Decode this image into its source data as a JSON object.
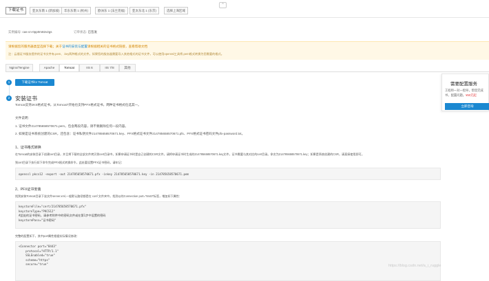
{
  "top_tabs": [
    {
      "label": "下载证书",
      "active": true
    },
    {
      "label": "亚太东南 1 (新加坡)",
      "active": false
    },
    {
      "label": "华东东南 1 (杭州)",
      "active": false
    },
    {
      "label": "欧洲东 1 (法兰克福)",
      "active": false
    },
    {
      "label": "亚太东北 1 (东京)",
      "active": false
    },
    {
      "label": "选择上海区域",
      "active": false
    }
  ],
  "up_button": "^",
  "order": {
    "instance_label": "实例编号:",
    "instance_value": "cas-cn-0pp0m82v2gs",
    "status_label": "订单状态:",
    "status_value": "已签发"
  },
  "notice": {
    "line1_prefix": "请根据您的服务器类型选择下载；关于",
    "line1_link": "证书的安装与配置",
    "line1_suffix": "请根据相关的证书格式链接，查看帮助文档",
    "line2": "注：云盾证书服务提供的证书文件有.pem、.key两种格式的文件。如果您的服务器需要导入其他格式的证书文件，可以使用openssl工具将.pem格式转换为您需要的格式。"
  },
  "server_tabs": [
    "Nginx/Tengine",
    "Apache",
    "Tomcat",
    "IIS 6",
    "IIS 7/8",
    "其他"
  ],
  "active_server_tab": 2,
  "step1": {
    "number": "1",
    "button": "下载证书for Tomcat"
  },
  "step2": {
    "number": "2",
    "title": "安装证书",
    "intro": "Tomcat支持JKS格式证书，从Tomcat7开始也支持PFX格式证书，两种证书格式任选其一。",
    "files_heading": "文件说明：",
    "file1": "1. 证书文件214785658570671.pem，包含两段内容，请不要删除任何一段内容。",
    "file2": "2. 如果是证书系统创建的CSR，还包含：证书私钥文件214785658570671.key、PFX格式证书文件214785658570671.pfx、PFX格式证书密码文件pfx-password.txt。",
    "sub1_title": "1、证书格式转换",
    "sub1_text1": "在Tomcat的安装目录下创建cert目录，并且将下载的全部文件拷贝到cert目录中。如果申请证书时是自己创建的CSR文件，请将申请证书时生成的214785658570671.key文件，证书需要与其对应的cert目录。命名为214785658570671.key；如果是系统创建的CSR，请直接使用即可。",
    "sub1_text2": "到cert目录下执行如下命令完成PFX格式转换命令，此处要设置PFX证书密码，请牢记：",
    "cmd1": "openssl pkcs12 -export -out 214785658570671.pfx -inkey 214785658570671.key -in 214785658570671.pem",
    "sub2_title": "2、PFX证书安装",
    "sub2_text": "找到安装Tomcat目录下该文件server.xml,一般默认路径都是在 conf 文件夹中。找到以的Connection port=\"8443\"标签，增加如下属性：",
    "code2": [
      "keystoreFile=\"cert/214785658570671.pfx\"",
      "keystoreType=\"PKCS12\"",
      "#此处的证书密码，请参考附件中的密码文件或在第1步中设置的密码",
      "keystorePass=\"证书密码\""
    ],
    "sub2_text2": "完整的配置如下，其中port属性根据实际情况修改：",
    "code3": [
      "<Connector port=\"8443\"",
      "    protocol=\"HTTP/1.1\"",
      "    SSLEnabled=\"true\"",
      "    scheme=\"https\"",
      "    secure=\"true\""
    ]
  },
  "promo": {
    "title": "需要配置服务",
    "line1": "工程师一对一指导，帮您完成",
    "line2_prefix": "书，配置问题。",
    "line2_price": "¥50元起",
    "button": "立即咨询"
  },
  "watermark": "https://blog.csdn.net/a_i_ruggle"
}
